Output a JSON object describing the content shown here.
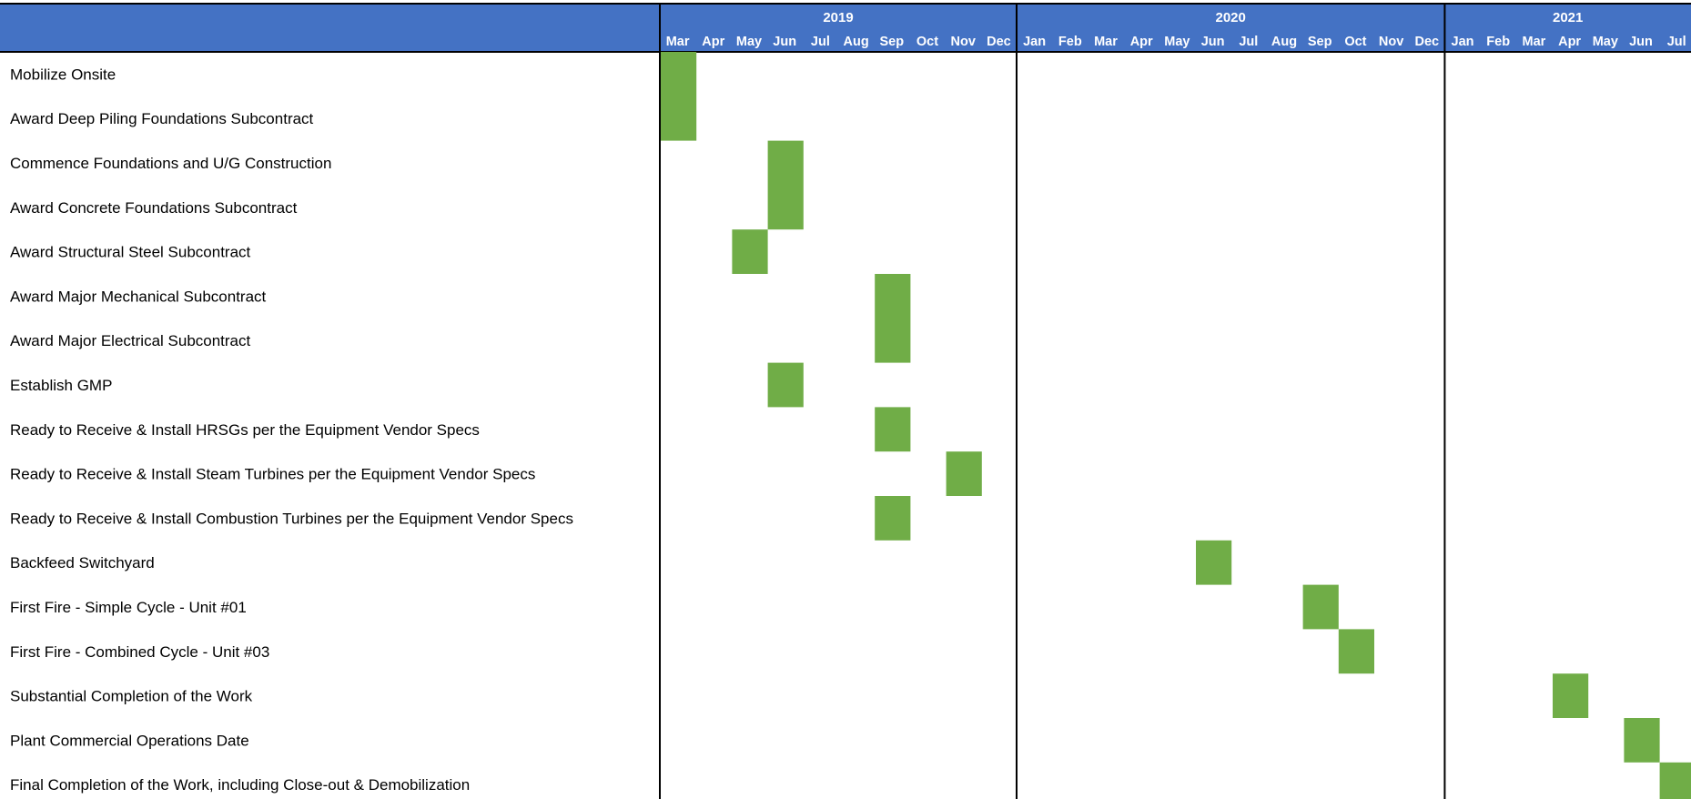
{
  "colors": {
    "header_bg": "#4472C4",
    "header_text": "#FFFFFF",
    "bar": "#70AD47",
    "grid_line": "#000000",
    "row_text": "#000000"
  },
  "chart_data": {
    "type": "gantt",
    "years": [
      {
        "label": "2019",
        "months": [
          "Mar",
          "Apr",
          "May",
          "Jun",
          "Jul",
          "Aug",
          "Sep",
          "Oct",
          "Nov",
          "Dec"
        ]
      },
      {
        "label": "2020",
        "months": [
          "Jan",
          "Feb",
          "Mar",
          "Apr",
          "May",
          "Jun",
          "Jul",
          "Aug",
          "Sep",
          "Oct",
          "Nov",
          "Dec"
        ]
      },
      {
        "label": "2021",
        "months": [
          "Jan",
          "Feb",
          "Mar",
          "Apr",
          "May",
          "Jun",
          "Jul"
        ]
      }
    ],
    "tasks": [
      {
        "name": "Mobilize Onsite",
        "start": "2019-03",
        "end": "2019-03",
        "bar_rows": [
          0,
          1
        ]
      },
      {
        "name": "Award Deep Piling Foundations Subcontract",
        "start": "2019-03",
        "end": "2019-03",
        "bar_rows": [
          0,
          1
        ]
      },
      {
        "name": "Commence Foundations and U/G Construction",
        "start": "2019-06",
        "end": "2019-06",
        "bar_rows": [
          2,
          3
        ]
      },
      {
        "name": "Award Concrete Foundations Subcontract",
        "start": "2019-06",
        "end": "2019-06",
        "bar_rows": [
          2,
          3
        ]
      },
      {
        "name": "Award Structural Steel Subcontract",
        "start": "2019-05",
        "end": "2019-05",
        "bar_rows": [
          4,
          4
        ]
      },
      {
        "name": "Award Major Mechanical Subcontract",
        "start": "2019-09",
        "end": "2019-09",
        "bar_rows": [
          5,
          6
        ]
      },
      {
        "name": "Award Major Electrical Subcontract",
        "start": "2019-09",
        "end": "2019-09",
        "bar_rows": [
          5,
          6
        ]
      },
      {
        "name": "Establish GMP",
        "start": "2019-06",
        "end": "2019-06",
        "bar_rows": [
          7,
          7
        ]
      },
      {
        "name": "Ready to Receive & Install HRSGs per the Equipment Vendor Specs",
        "start": "2019-09",
        "end": "2019-09",
        "bar_rows": [
          8,
          8
        ]
      },
      {
        "name": "Ready to Receive & Install Steam Turbines per the Equipment Vendor Specs",
        "start": "2019-11",
        "end": "2019-11",
        "bar_rows": [
          9,
          9
        ]
      },
      {
        "name": "Ready to Receive & Install Combustion Turbines per the Equipment Vendor Specs",
        "start": "2019-09",
        "end": "2019-09",
        "bar_rows": [
          10,
          10
        ]
      },
      {
        "name": "Backfeed Switchyard",
        "start": "2020-06",
        "end": "2020-06",
        "bar_rows": [
          11,
          11
        ]
      },
      {
        "name": "First Fire - Simple Cycle - Unit #01",
        "start": "2020-09",
        "end": "2020-09",
        "bar_rows": [
          12,
          12
        ]
      },
      {
        "name": "First Fire - Combined Cycle - Unit #03",
        "start": "2020-10",
        "end": "2020-10",
        "bar_rows": [
          13,
          13
        ]
      },
      {
        "name": "Substantial Completion of the Work",
        "start": "2021-04",
        "end": "2021-04",
        "bar_rows": [
          14,
          14
        ]
      },
      {
        "name": "Plant Commercial Operations Date",
        "start": "2021-06",
        "end": "2021-06",
        "bar_rows": [
          15,
          15
        ]
      },
      {
        "name": "Final Completion of the Work, including Close-out & Demobilization",
        "start": "2021-07",
        "end": "2021-07",
        "bar_rows": [
          16,
          16
        ]
      }
    ]
  }
}
